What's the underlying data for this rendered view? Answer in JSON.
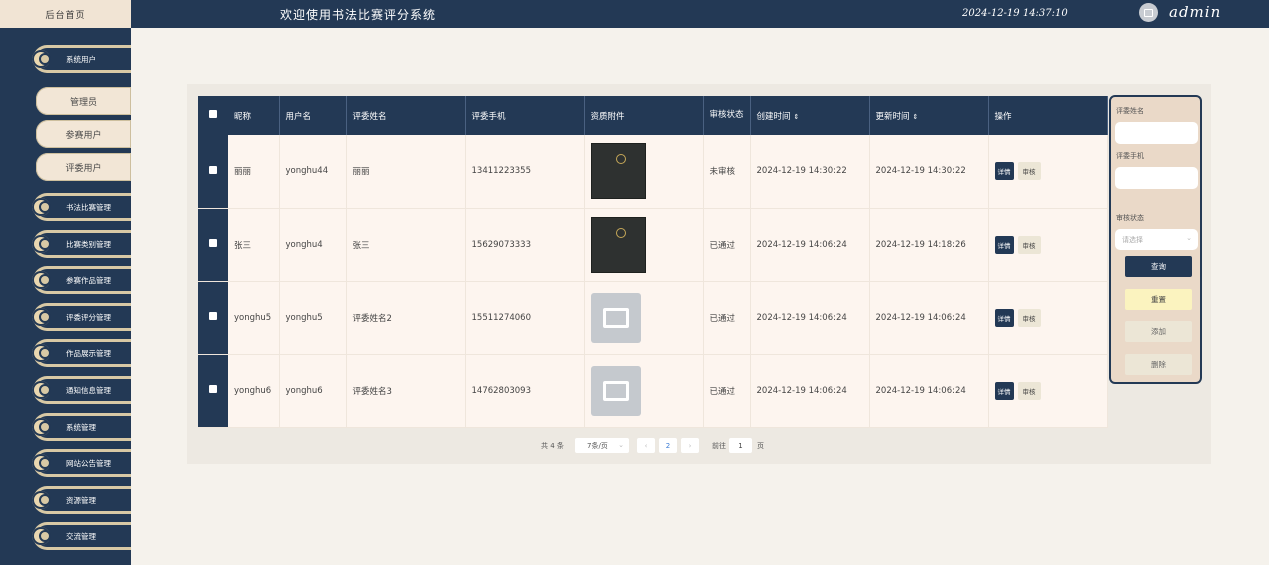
{
  "header": {
    "brand": "后台首页",
    "title": "欢迎使用书法比赛评分系统",
    "datetime": "2024-12-19 14:37:10",
    "user": "admin"
  },
  "sidebar": {
    "items": [
      {
        "label": "系统用户"
      },
      {
        "label": "书法比赛管理"
      },
      {
        "label": "比赛类别管理"
      },
      {
        "label": "参赛作品管理"
      },
      {
        "label": "评委评分管理"
      },
      {
        "label": "作品展示管理"
      },
      {
        "label": "通知信息管理"
      },
      {
        "label": "系统管理"
      },
      {
        "label": "网站公告管理"
      },
      {
        "label": "资源管理"
      },
      {
        "label": "交流管理"
      }
    ],
    "subitems": [
      {
        "label": "管理员"
      },
      {
        "label": "参赛用户"
      },
      {
        "label": "评委用户"
      }
    ]
  },
  "table": {
    "columns": [
      "昵称",
      "用户名",
      "评委姓名",
      "评委手机",
      "资质附件",
      "审核状态",
      "创建时间",
      "更新时间",
      "操作"
    ],
    "sort_icon": "⇕",
    "rows": [
      {
        "nickname": "丽丽",
        "username": "yonghu44",
        "judge_name": "丽丽",
        "phone": "13411223355",
        "attachment": "photo",
        "status": "未审核",
        "created": "2024-12-19 14:30:22",
        "updated": "2024-12-19 14:30:22"
      },
      {
        "nickname": "张三",
        "username": "yonghu4",
        "judge_name": "张三",
        "phone": "15629073333",
        "attachment": "photo",
        "status": "已通过",
        "created": "2024-12-19 14:06:24",
        "updated": "2024-12-19 14:18:26"
      },
      {
        "nickname": "yonghu5",
        "username": "yonghu5",
        "judge_name": "评委姓名2",
        "phone": "15511274060",
        "attachment": "placeholder",
        "status": "已通过",
        "created": "2024-12-19 14:06:24",
        "updated": "2024-12-19 14:06:24"
      },
      {
        "nickname": "yonghu6",
        "username": "yonghu6",
        "judge_name": "评委姓名3",
        "phone": "14762803093",
        "attachment": "placeholder",
        "status": "已通过",
        "created": "2024-12-19 14:06:24",
        "updated": "2024-12-19 14:06:24"
      }
    ],
    "actions": {
      "detail": "详情",
      "audit": "审核"
    }
  },
  "search": {
    "judge_name_label": "评委姓名",
    "judge_phone_label": "评委手机",
    "status_label": "审核状态",
    "status_placeholder": "请选择",
    "query": "查询",
    "reset": "重置",
    "add": "添加",
    "delete": "删除"
  },
  "pagination": {
    "total": "共 4 条",
    "page_size": "7条/页",
    "current": "2",
    "goto_label": "前往",
    "goto_value": "1",
    "page_unit": "页"
  },
  "colors": {
    "primary": "#233955",
    "accent": "#d8c9a5",
    "row_bg": "#fdf5ef"
  }
}
